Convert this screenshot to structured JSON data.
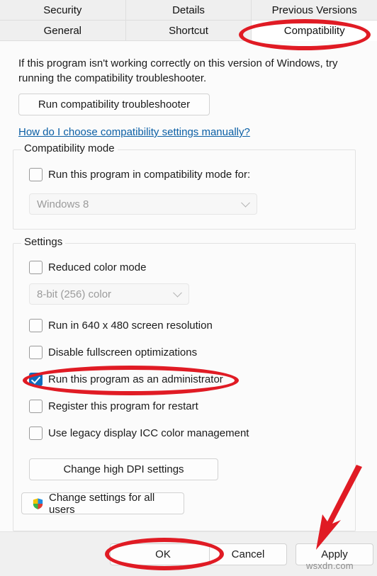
{
  "dialog": {
    "tabs_row1": [
      {
        "label": "Security",
        "selected": false
      },
      {
        "label": "Details",
        "selected": false
      },
      {
        "label": "Previous Versions",
        "selected": false
      }
    ],
    "tabs_row2": [
      {
        "label": "General",
        "selected": false
      },
      {
        "label": "Shortcut",
        "selected": false
      },
      {
        "label": "Compatibility",
        "selected": true
      }
    ]
  },
  "body": {
    "intro_text": "If this program isn't working correctly on this version of Windows, try running the compatibility troubleshooter.",
    "troubleshoot_button": "Run compatibility troubleshooter",
    "help_link": "How do I choose compatibility settings manually?"
  },
  "compatibility_mode": {
    "group_title": "Compatibility mode",
    "checkbox_label": "Run this program in compatibility mode for:",
    "checkbox_checked": false,
    "os_value": "Windows 8",
    "os_disabled": true
  },
  "settings": {
    "group_title": "Settings",
    "reduced_color_label": "Reduced color mode",
    "reduced_color_checked": false,
    "color_depth_value": "8-bit (256) color",
    "color_depth_disabled": true,
    "items": [
      {
        "label": "Run in 640 x 480 screen resolution",
        "checked": false
      },
      {
        "label": "Disable fullscreen optimizations",
        "checked": false
      },
      {
        "label": "Run this program as an administrator",
        "checked": true
      },
      {
        "label": "Register this program for restart",
        "checked": false
      },
      {
        "label": "Use legacy display ICC color management",
        "checked": false
      }
    ],
    "dpi_button": "Change high DPI settings"
  },
  "all_users": {
    "button_label": "Change settings for all users",
    "icon": "uac-shield-icon"
  },
  "footer": {
    "ok": "OK",
    "cancel": "Cancel",
    "apply": "Apply"
  },
  "watermark": "wsxdn.com",
  "annotations": {
    "color": "#e01b24",
    "shapes": [
      "ellipse-compatibility-tab",
      "ellipse-run-as-administrator",
      "ellipse-ok-button",
      "arrow-to-apply-button"
    ]
  }
}
